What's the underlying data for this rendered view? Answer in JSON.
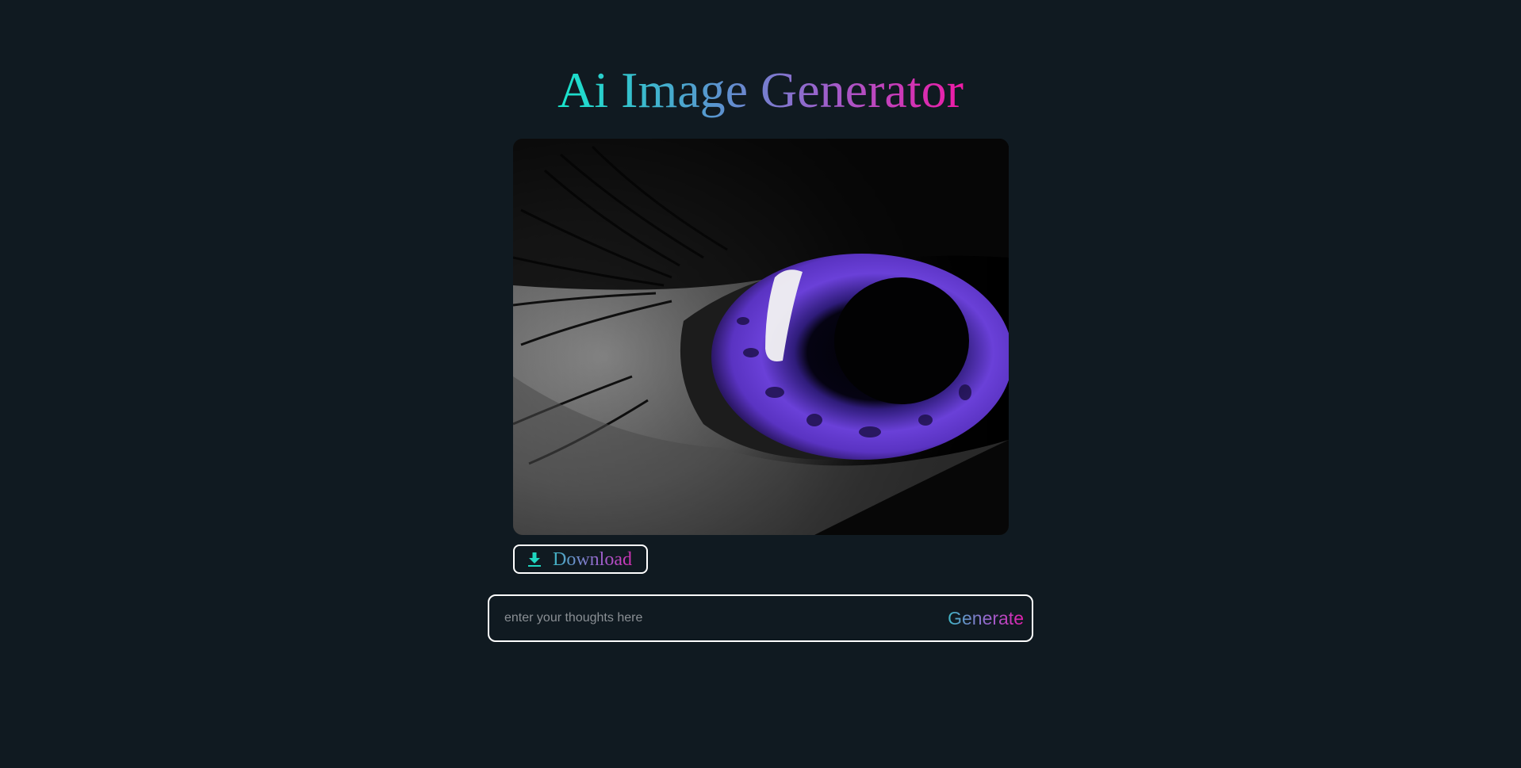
{
  "header": {
    "title": "Ai Image Generator"
  },
  "generated_image": {
    "description_icon": "generated-image",
    "iris_color": "#6a40d8"
  },
  "download": {
    "label": "Download",
    "icon": "download-icon"
  },
  "prompt": {
    "placeholder": "enter your thoughts here",
    "value": ""
  },
  "generate": {
    "label": "Generate"
  },
  "theme": {
    "background": "#101a21",
    "gradient_start": "#17e5cb",
    "gradient_end": "#f01aa6",
    "border": "#ffffff"
  }
}
